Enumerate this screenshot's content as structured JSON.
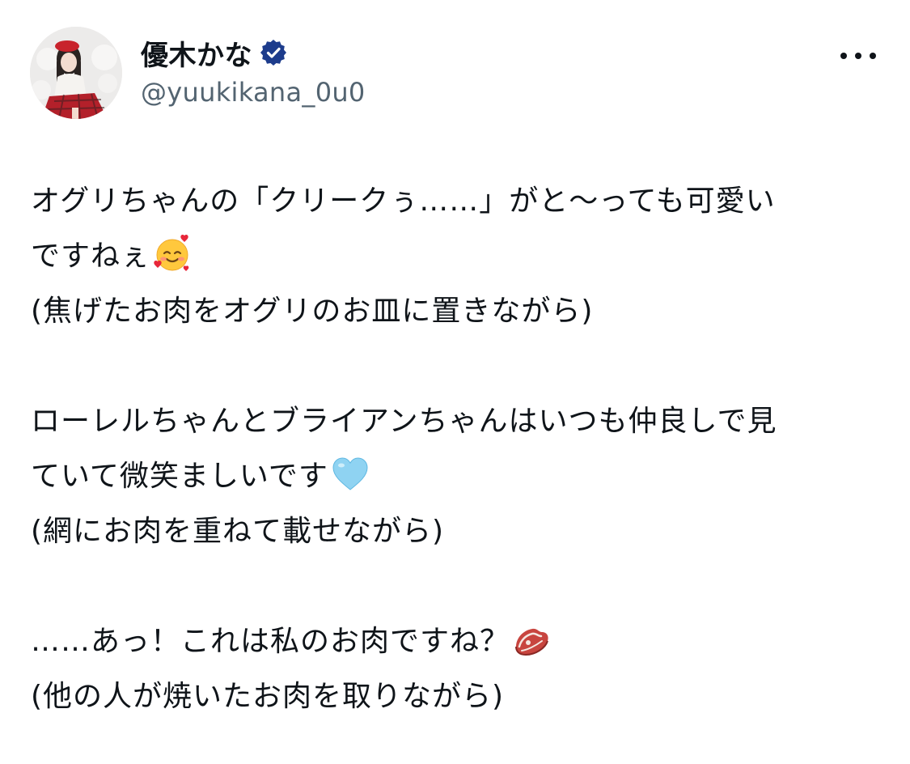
{
  "author": {
    "display_name": "優木かな",
    "handle": "@yuukikana_0u0",
    "verified": true,
    "avatar_icon": "avatar-photo"
  },
  "menu": {
    "icon": "more-horizontal-icon"
  },
  "tweet": {
    "p1": {
      "line1": "オグリちゃんの「クリークぅ……」がと〜っても可愛い",
      "line2": "ですねぇ",
      "line2_emoji": "smiling-face-with-hearts-emoji",
      "line3": "(焦げたお肉をオグリのお皿に置きながら)"
    },
    "p2": {
      "line1": "ローレルちゃんとブライアンちゃんはいつも仲良しで見",
      "line2": "ていて微笑ましいです",
      "line2_emoji": "light-blue-heart-emoji",
      "line3": "(網にお肉を重ねて載せながら)"
    },
    "p3": {
      "line1": "……あっ！これは私のお肉ですね？",
      "line1_emoji": "cut-of-meat-emoji",
      "line2": "(他の人が焼いたお肉を取りながら)"
    }
  },
  "colors": {
    "text": "#0f1419",
    "secondary": "#536471",
    "verified_badge": "#1d3c8c"
  }
}
